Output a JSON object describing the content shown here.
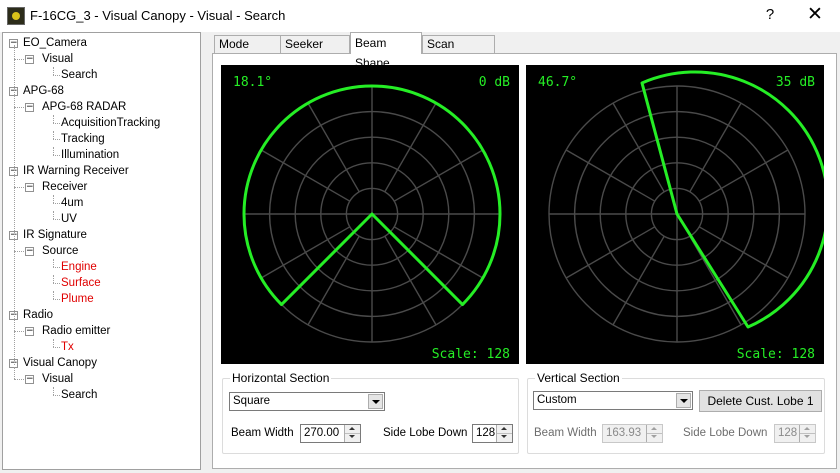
{
  "window": {
    "title": "F-16CG_3 - Visual Canopy - Visual - Search",
    "help_label": "?",
    "close_label": "✕",
    "icon": "app-logo-icon"
  },
  "tree": [
    {
      "label": "EO_Camera",
      "level": 0,
      "expander": "-"
    },
    {
      "label": "Visual",
      "level": 1,
      "expander": "-"
    },
    {
      "label": "Search",
      "level": 2
    },
    {
      "label": "APG-68",
      "level": 0,
      "expander": "-"
    },
    {
      "label": "APG-68 RADAR",
      "level": 1,
      "expander": "-"
    },
    {
      "label": "AcquisitionTracking",
      "level": 2
    },
    {
      "label": "Tracking",
      "level": 2
    },
    {
      "label": "Illumination",
      "level": 2
    },
    {
      "label": "IR Warning Receiver",
      "level": 0,
      "expander": "-"
    },
    {
      "label": "Receiver",
      "level": 1,
      "expander": "-"
    },
    {
      "label": "4um",
      "level": 2
    },
    {
      "label": "UV",
      "level": 2
    },
    {
      "label": "IR Signature",
      "level": 0,
      "expander": "-"
    },
    {
      "label": "Source",
      "level": 1,
      "expander": "-"
    },
    {
      "label": "Engine",
      "level": 2,
      "red": true
    },
    {
      "label": "Surface",
      "level": 2,
      "red": true
    },
    {
      "label": "Plume",
      "level": 2,
      "red": true
    },
    {
      "label": "Radio",
      "level": 0,
      "expander": "-"
    },
    {
      "label": "Radio emitter",
      "level": 1,
      "expander": "-"
    },
    {
      "label": "Tx",
      "level": 2,
      "red": true
    },
    {
      "label": "Visual Canopy",
      "level": 0,
      "expander": "-"
    },
    {
      "label": "Visual",
      "level": 1,
      "expander": "-"
    },
    {
      "label": "Search",
      "level": 2
    }
  ],
  "tabs": [
    "Mode Data",
    "Seeker Data",
    "Beam Shape",
    "Scan Pattern"
  ],
  "active_tab": 2,
  "plots": {
    "left": {
      "angle_label": "18.1°",
      "db_label": "0 dB",
      "scale_label": "Scale: 128",
      "beam_width_deg": 270
    },
    "right": {
      "angle_label": "46.7°",
      "db_label": "35 dB",
      "scale_label": "Scale: 128"
    }
  },
  "horizontal": {
    "title": "Horizontal Section",
    "shape": "Square",
    "beam_width_label": "Beam Width",
    "beam_width": "270.00",
    "side_lobe_label": "Side Lobe Down",
    "side_lobe": "128"
  },
  "vertical": {
    "title": "Vertical Section",
    "shape": "Custom",
    "delete_button": "Delete Cust. Lobe 1",
    "beam_width_label": "Beam Width",
    "beam_width": "163.93",
    "side_lobe_label": "Side Lobe Down",
    "side_lobe": "128"
  },
  "colors": {
    "plot_bg": "#000000",
    "grid": "#4a4a4a",
    "beam": "#25ee25",
    "red_item": "#e00000"
  }
}
